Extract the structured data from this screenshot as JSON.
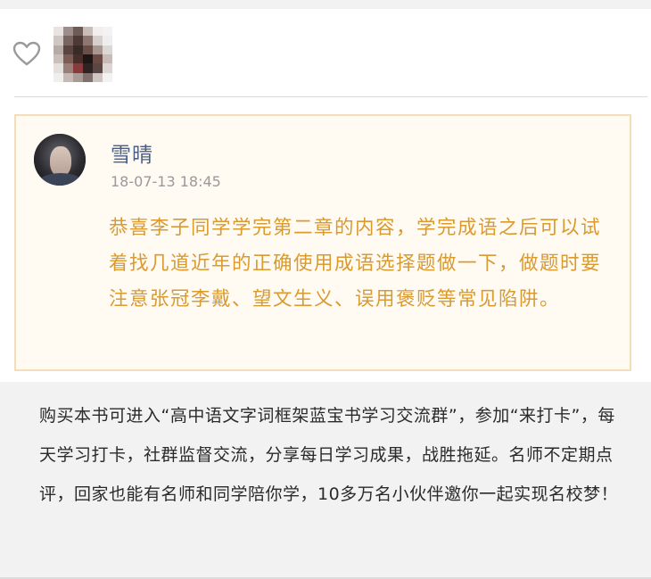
{
  "comment": {
    "author": "雪晴",
    "time": "18-07-13 18:45",
    "text": "恭喜李子同学学完第二章的内容，学完成语之后可以试着找几道近年的正确使用成语选择题做一下，做题时要注意张冠李戴、望文生义、误用褒贬等常见陷阱。"
  },
  "promo": {
    "text": "购买本书可进入“高中语文字词框架蓝宝书学习交流群”，参加“来打卡”，每天学习打卡，社群监督交流，分享每日学习成果，战胜拖延。名师不定期点评，回家也能有名师和同学陪你学，10多万名小伙伴邀你一起实现名校梦！"
  },
  "icons": {
    "like": "heart-outline-icon",
    "liker_avatar": "pixelated-avatar",
    "commenter_avatar": "user-avatar"
  },
  "colors": {
    "comment_text": "#d99a30",
    "author_name": "#4a5f82",
    "comment_border": "#f5ddb5",
    "comment_bg": "#fffaf2"
  }
}
